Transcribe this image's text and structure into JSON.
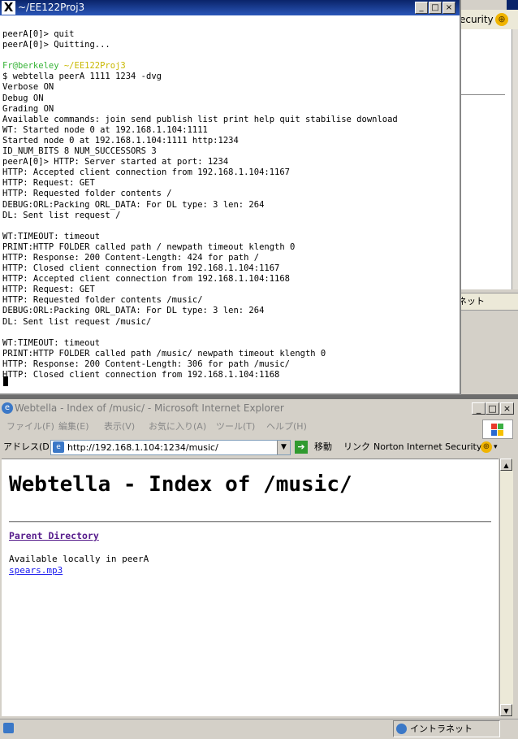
{
  "background_window": {
    "toolbar_text": "ecurity",
    "globe_glyph": "⊕",
    "status_text": "ネット"
  },
  "terminal": {
    "title_icon": "X",
    "title": "~/EE122Proj3",
    "buttons": [
      "_",
      "□",
      "×"
    ],
    "lines": [
      {
        "text": "peerA[0]> quit",
        "color": "default"
      },
      {
        "text": "peerA[0]> Quitting...",
        "color": "default"
      },
      {
        "text": "",
        "color": "default"
      },
      {
        "text": "Fr@berkeley ",
        "color": "green",
        "suffix": "~/EE122Proj3",
        "suffix_color": "yellow"
      },
      {
        "text": "$ webtella peerA 1111 1234 -dvg",
        "color": "default"
      },
      {
        "text": "Verbose ON",
        "color": "default"
      },
      {
        "text": "Debug ON",
        "color": "default"
      },
      {
        "text": "Grading ON",
        "color": "default"
      },
      {
        "text": "Available commands: join send publish list print help quit stabilise download",
        "color": "default"
      },
      {
        "text": "WT: Started node 0 at 192.168.1.104:1111",
        "color": "default"
      },
      {
        "text": "Started node 0 at 192.168.1.104:1111 http:1234",
        "color": "default"
      },
      {
        "text": "ID_NUM_BITS 8 NUM_SUCCESSORS 3",
        "color": "default"
      },
      {
        "text": "peerA[0]> HTTP: Server started at port: 1234",
        "color": "default"
      },
      {
        "text": "HTTP: Accepted client connection from 192.168.1.104:1167",
        "color": "default"
      },
      {
        "text": "HTTP: Request: GET",
        "color": "default"
      },
      {
        "text": "HTTP: Requested folder contents /",
        "color": "default"
      },
      {
        "text": "DEBUG:ORL:Packing ORL_DATA: For DL type: 3 len: 264",
        "color": "default"
      },
      {
        "text": "DL: Sent list request /",
        "color": "default"
      },
      {
        "text": "",
        "color": "default"
      },
      {
        "text": "WT:TIMEOUT: timeout",
        "color": "default"
      },
      {
        "text": "PRINT:HTTP FOLDER called path / newpath timeout klength 0",
        "color": "default"
      },
      {
        "text": "HTTP: Response: 200 Content-Length: 424 for path /",
        "color": "default"
      },
      {
        "text": "HTTP: Closed client connection from 192.168.1.104:1167",
        "color": "default"
      },
      {
        "text": "HTTP: Accepted client connection from 192.168.1.104:1168",
        "color": "default"
      },
      {
        "text": "HTTP: Request: GET",
        "color": "default"
      },
      {
        "text": "HTTP: Requested folder contents /music/",
        "color": "default"
      },
      {
        "text": "DEBUG:ORL:Packing ORL_DATA: For DL type: 3 len: 264",
        "color": "default"
      },
      {
        "text": "DL: Sent list request /music/",
        "color": "default"
      },
      {
        "text": "",
        "color": "default"
      },
      {
        "text": "WT:TIMEOUT: timeout",
        "color": "default"
      },
      {
        "text": "PRINT:HTTP FOLDER called path /music/ newpath timeout klength 0",
        "color": "default"
      },
      {
        "text": "HTTP: Response: 200 Content-Length: 306 for path /music/",
        "color": "default"
      },
      {
        "text": "HTTP: Closed client connection from 192.168.1.104:1168",
        "color": "default"
      }
    ],
    "colors": {
      "green": "#36b336",
      "yellow": "#c9b800"
    }
  },
  "browser": {
    "title": "Webtella - Index of /music/ - Microsoft Internet Explorer",
    "title_icon": "e",
    "buttons": [
      "_",
      "□",
      "×"
    ],
    "menu": [
      "ファイル(F)",
      "編集(E)",
      "表示(V)",
      "お気に入り(A)",
      "ツール(T)",
      "ヘルプ(H)"
    ],
    "address_label": "アドレス(D)",
    "address_value": "http://192.168.1.104:1234/music/",
    "dropdown_glyph": "▼",
    "go_arrow": "➔",
    "go_label": "移動",
    "links_label": "リンク",
    "norton_label": "Norton Internet Security",
    "globe_glyph": "⊕",
    "globe_dropdown": "▾",
    "scroll_up": "▲",
    "scroll_down": "▼",
    "page": {
      "heading": "Webtella - Index of /music/",
      "parent_link": "Parent Directory",
      "available_text": "Available locally in peerA",
      "file_link": "spears.mp3"
    },
    "status_zone": "イントラネット"
  }
}
